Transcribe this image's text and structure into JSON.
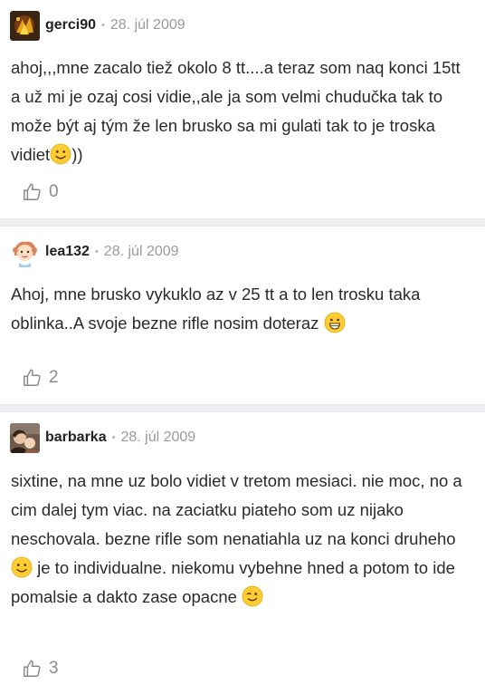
{
  "comments": [
    {
      "username": "gerci90",
      "date": "28. júl 2009",
      "text": "ahoj,,,mne zacalo tiež okolo 8 tt....a teraz som naq konci 15tt a už mi je ozaj cosi vidie,,ale ja som velmi chudučka tak to može být aj tým že len brusko sa mi gulati tak to je troska vidiet",
      "text_after": "))",
      "likes": "0"
    },
    {
      "username": "lea132",
      "date": "28. júl 2009",
      "text": "Ahoj, mne brusko vykuklo az v 25 tt a to len trosku taka oblinka..A svoje bezne rifle nosim doteraz ",
      "likes": "2"
    },
    {
      "username": "barbarka",
      "date": "28. júl 2009",
      "text_part1": "sixtine, na mne uz bolo vidiet v tretom mesiaci. nie moc, no a cim dalej tym viac. na zaciatku piateho som uz nijako neschovala. bezne rifle som nenatiahla uz na konci druheho ",
      "text_part2": " je to individualne. niekomu vybehne hned a potom to ide pomalsie a dakto zase opacne ",
      "likes": "3"
    }
  ],
  "icons": {
    "like": "thumbs-up-icon",
    "smile": "smile-emoji",
    "grin": "grin-emoji",
    "wink": "wink-emoji"
  },
  "colors": {
    "separator": "#f0f0f2",
    "date": "#9a9a9a",
    "emoji": "#ffcc33"
  }
}
